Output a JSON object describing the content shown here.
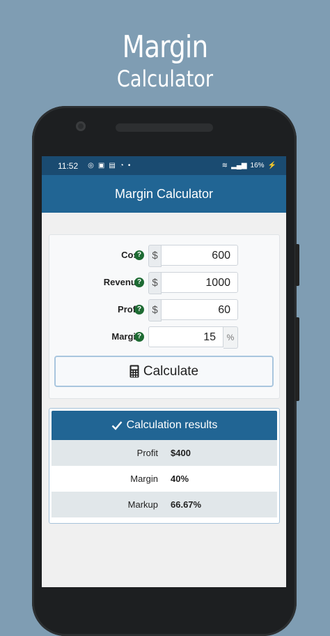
{
  "promo": {
    "line1": "Margin",
    "line2": "Calculator"
  },
  "status_bar": {
    "time": "11:52",
    "battery": "16%"
  },
  "app_bar": {
    "title": "Margin Calculator"
  },
  "form": {
    "rows": [
      {
        "label": "Cost",
        "prefix": "$",
        "value": "600"
      },
      {
        "label": "Revenue",
        "prefix": "$",
        "value": "1000"
      },
      {
        "label": "Profit",
        "prefix": "$",
        "value": "60"
      },
      {
        "label": "Margin",
        "suffix": "%",
        "value": "15"
      }
    ],
    "help_symbol": "?",
    "calculate_label": "Calculate"
  },
  "results": {
    "title": "Calculation results",
    "rows": [
      {
        "label": "Profit",
        "value": "$400"
      },
      {
        "label": "Margin",
        "value": "40%"
      },
      {
        "label": "Markup",
        "value": "66.67%"
      }
    ]
  },
  "colors": {
    "background": "#7f9db3",
    "status_bar": "#1a4b71",
    "primary": "#216594",
    "help_icon": "#1e6b33"
  }
}
